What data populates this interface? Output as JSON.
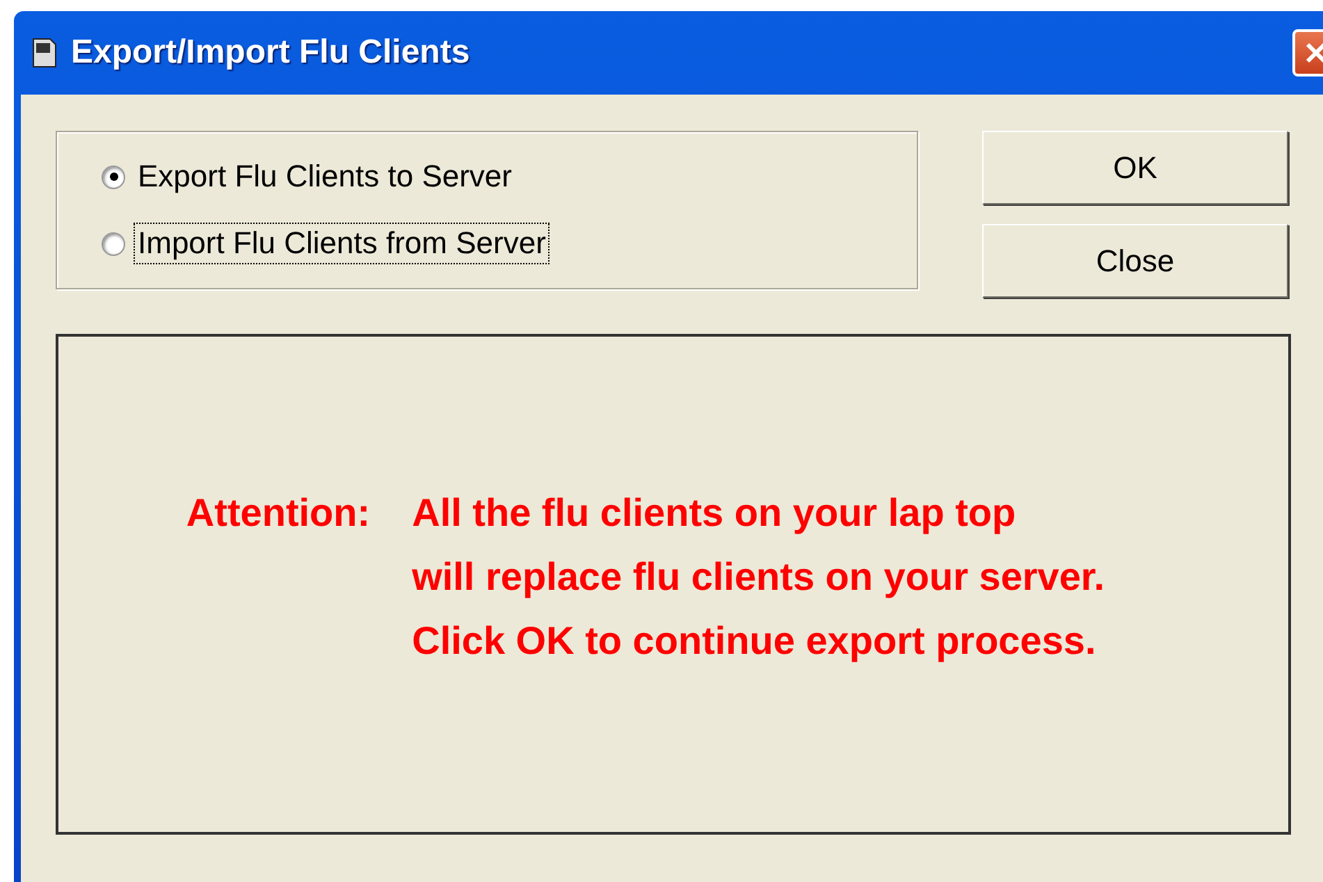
{
  "window": {
    "title": "Export/Import Flu Clients"
  },
  "options": [
    {
      "label": "Export Flu Clients to Server",
      "selected": true,
      "focused": false
    },
    {
      "label": "Import Flu Clients from Server",
      "selected": false,
      "focused": true
    }
  ],
  "buttons": [
    "OK",
    "Close"
  ],
  "message": {
    "label": "Attention:",
    "lines": [
      "All the flu clients on your lap top",
      "will replace flu clients on your server.",
      "Click OK to continue export process."
    ]
  }
}
